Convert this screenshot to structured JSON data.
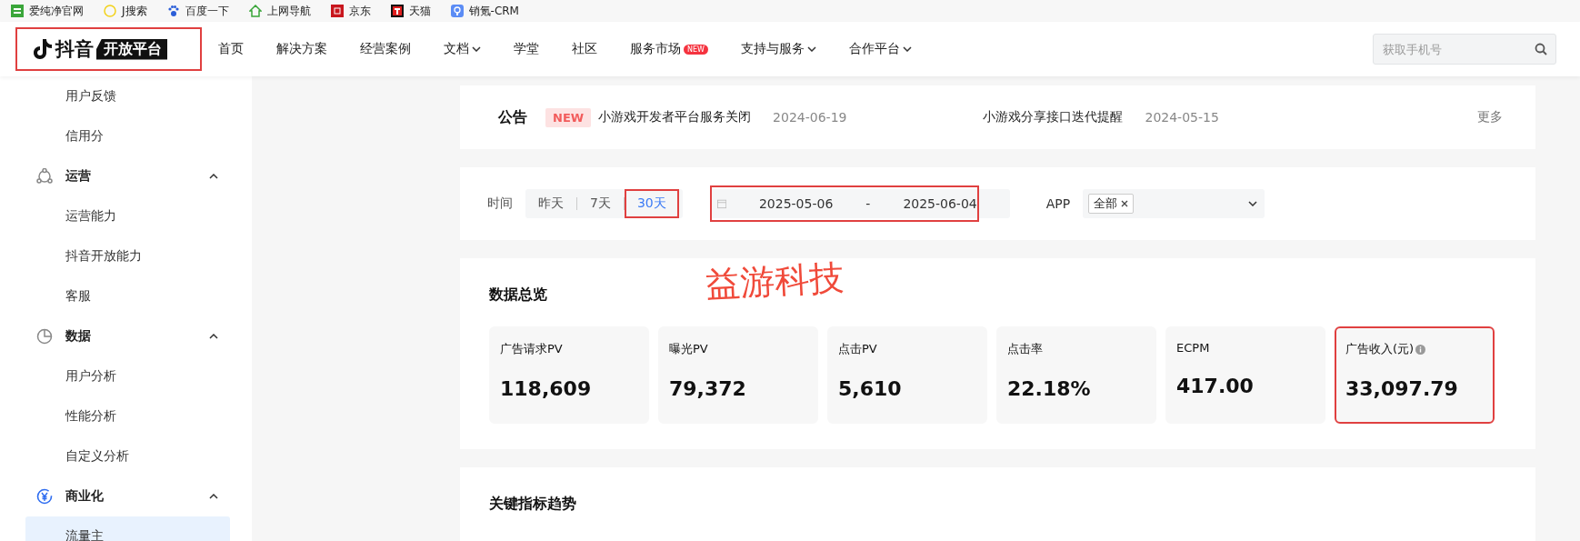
{
  "bookmarks": [
    {
      "label": "爱纯净官网"
    },
    {
      "label": "J搜索"
    },
    {
      "label": "百度一下"
    },
    {
      "label": "上网导航"
    },
    {
      "label": "京东"
    },
    {
      "label": "天猫"
    },
    {
      "label": "销氪-CRM"
    }
  ],
  "header": {
    "logo": {
      "brand": "抖音",
      "tag": "开放平台",
      "highlighted": true
    },
    "nav": [
      {
        "label": "首页",
        "dropdown": false
      },
      {
        "label": "解决方案",
        "dropdown": false
      },
      {
        "label": "经营案例",
        "dropdown": false
      },
      {
        "label": "文档",
        "dropdown": true
      },
      {
        "label": "学堂",
        "dropdown": false
      },
      {
        "label": "社区",
        "dropdown": false
      },
      {
        "label": "服务市场",
        "dropdown": false,
        "badge": "NEW"
      },
      {
        "label": "支持与服务",
        "dropdown": true
      },
      {
        "label": "合作平台",
        "dropdown": true
      }
    ],
    "search": {
      "placeholder": "获取手机号"
    }
  },
  "sidebar": {
    "items": [
      {
        "label": "用户反馈",
        "kind": "item",
        "selected": false
      },
      {
        "label": "信用分",
        "kind": "item",
        "selected": false
      },
      {
        "label": "运营",
        "kind": "group",
        "expanded": true
      },
      {
        "label": "运营能力",
        "kind": "item",
        "selected": false
      },
      {
        "label": "抖音开放能力",
        "kind": "item",
        "selected": false
      },
      {
        "label": "客服",
        "kind": "item",
        "selected": false
      },
      {
        "label": "数据",
        "kind": "group",
        "expanded": true
      },
      {
        "label": "用户分析",
        "kind": "item",
        "selected": false
      },
      {
        "label": "性能分析",
        "kind": "item",
        "selected": false
      },
      {
        "label": "自定义分析",
        "kind": "item",
        "selected": false
      },
      {
        "label": "商业化",
        "kind": "group",
        "expanded": true
      },
      {
        "label": "流量主",
        "kind": "item",
        "selected": true
      }
    ]
  },
  "notice": {
    "title": "公告",
    "badge": "NEW",
    "items": [
      {
        "text": "小游戏开发者平台服务关闭",
        "date": "2024-06-19"
      },
      {
        "text": "小游戏分享接口迭代提醒",
        "date": "2024-05-15"
      }
    ],
    "more": "更多"
  },
  "filter": {
    "label": "时间",
    "ranges": [
      {
        "label": "昨天",
        "selected": false,
        "highlighted": false
      },
      {
        "label": "7天",
        "selected": false,
        "highlighted": false
      },
      {
        "label": "30天",
        "selected": true,
        "highlighted": true
      }
    ],
    "date_range": {
      "start": "2025-05-06",
      "separator": "-",
      "end": "2025-06-04",
      "highlighted": true
    },
    "app": {
      "label": "APP",
      "tags": [
        "全部"
      ]
    }
  },
  "annotation": "益游科技",
  "overview": {
    "title": "数据总览",
    "metrics": [
      {
        "label": "广告请求PV",
        "value": "118,609",
        "info": false,
        "highlighted": false
      },
      {
        "label": "曝光PV",
        "value": "79,372",
        "info": false,
        "highlighted": false
      },
      {
        "label": "点击PV",
        "value": "5,610",
        "info": false,
        "highlighted": false
      },
      {
        "label": "点击率",
        "value": "22.18%",
        "info": false,
        "highlighted": false
      },
      {
        "label": "ECPM",
        "value": "417.00",
        "info": false,
        "highlighted": false
      },
      {
        "label": "广告收入(元)",
        "value": "33,097.79",
        "info": true,
        "highlighted": true
      }
    ]
  },
  "trends": {
    "title": "关键指标趋势"
  }
}
